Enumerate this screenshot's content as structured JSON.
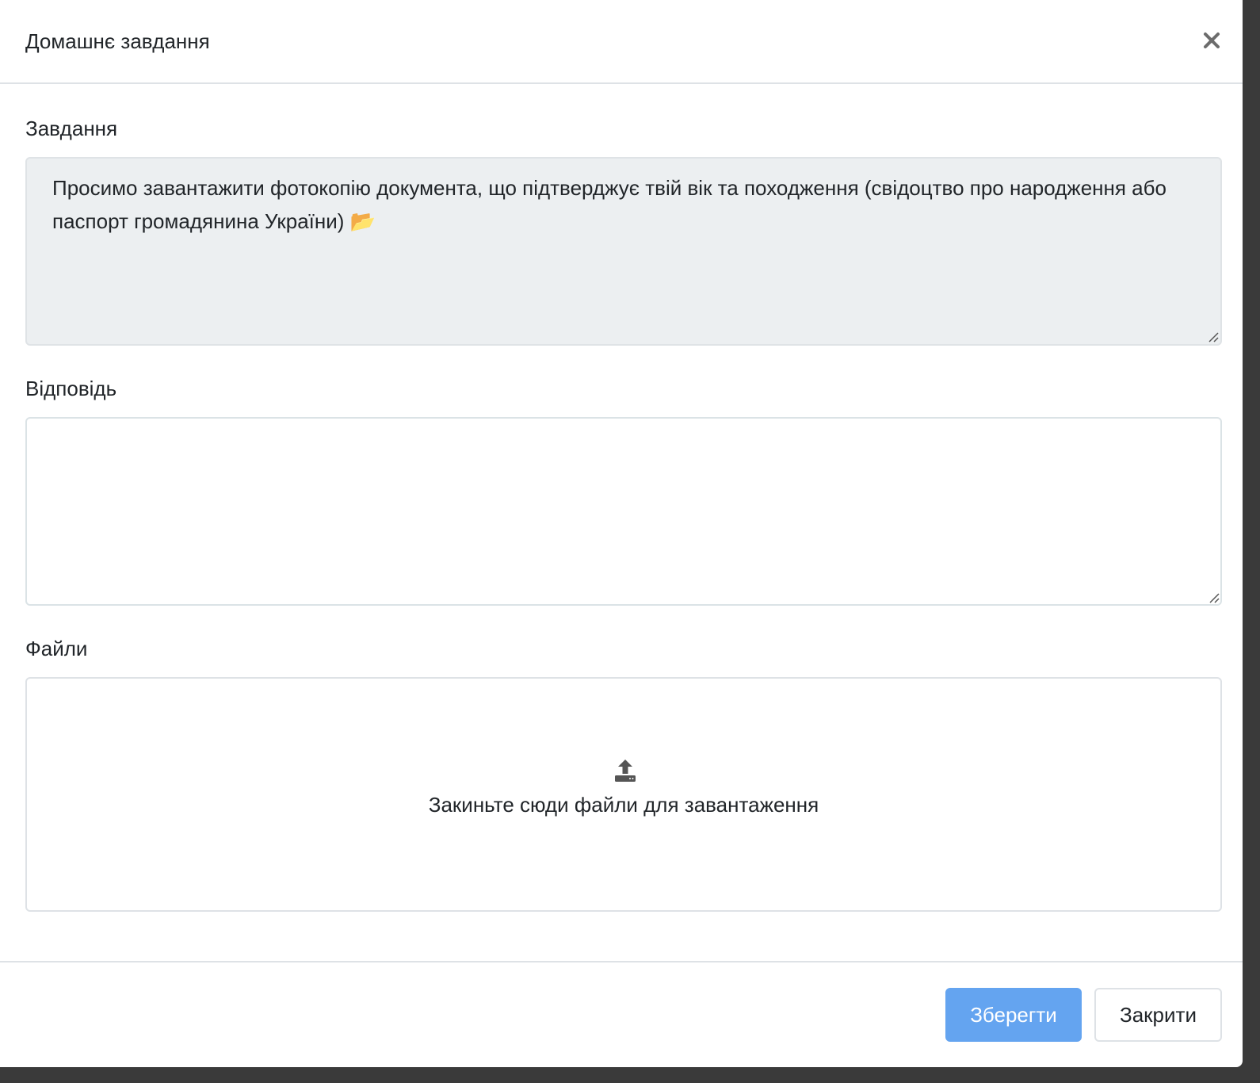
{
  "modal": {
    "title": "Домашнє завдання",
    "close_icon": "close-icon"
  },
  "task": {
    "label": "Завдання",
    "text": "Просимо завантажити фотокопію документа, що підтверджує твій вік та походження (свідоцтво про народження або паспорт громадянина України)",
    "trailing_icon": "📂"
  },
  "answer": {
    "label": "Відповідь",
    "value": ""
  },
  "files": {
    "label": "Файли",
    "dropzone_icon": "upload-icon",
    "dropzone_text": "Закиньте сюди файли для завантаження"
  },
  "footer": {
    "save_label": "Зберегти",
    "close_label": "Закрити"
  },
  "colors": {
    "primary": "#64a4f0",
    "readonly_bg": "#eceff1",
    "border": "#dee2e6",
    "text": "#212529"
  }
}
